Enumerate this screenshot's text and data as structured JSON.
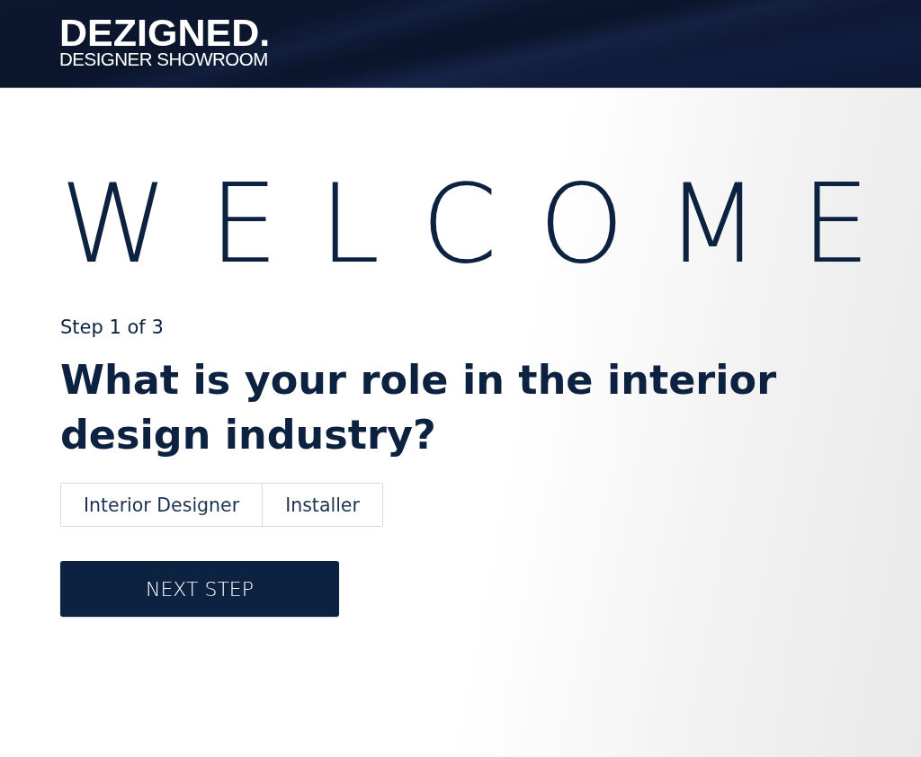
{
  "header": {
    "logo": {
      "title": "DEZIGNED.",
      "subtitle": "DESIGNER SHOWROOM"
    }
  },
  "welcome": "WELCOME",
  "step": "Step 1 of 3",
  "question": "What is your role in the interior design industry?",
  "options": [
    {
      "label": "Interior Designer",
      "selected": false
    },
    {
      "label": "Installer",
      "selected": false
    }
  ],
  "next_button": "NEXT STEP"
}
